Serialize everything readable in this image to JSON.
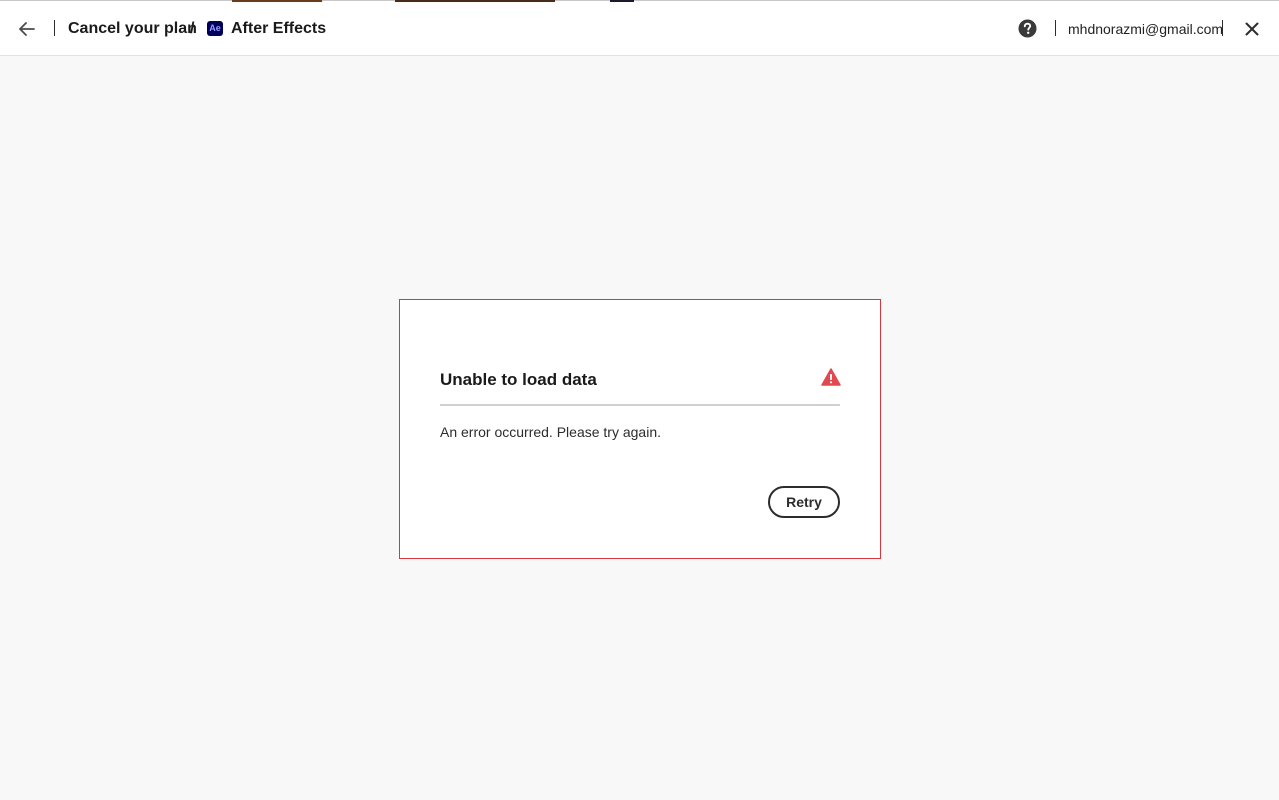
{
  "header": {
    "back_icon": "arrow-left-icon",
    "breadcrumb_title": "Cancel your plan",
    "breadcrumb_separator": "/",
    "product_logo_text": "Ae",
    "product_name": "After Effects",
    "help_icon": "help-circle-icon",
    "account_email": "mhdnorazmi@gmail.com",
    "close_icon": "close-icon"
  },
  "error_card": {
    "title": "Unable to load data",
    "alert_icon": "alert-triangle-icon",
    "message": "An error occurred. Please try again.",
    "retry_label": "Retry"
  },
  "colors": {
    "page_background": "#f8f8f8",
    "error_border": "#d7373f",
    "alert_icon": "#e34850",
    "ae_logo_background": "#00005b",
    "ae_logo_text": "#9999ff"
  }
}
